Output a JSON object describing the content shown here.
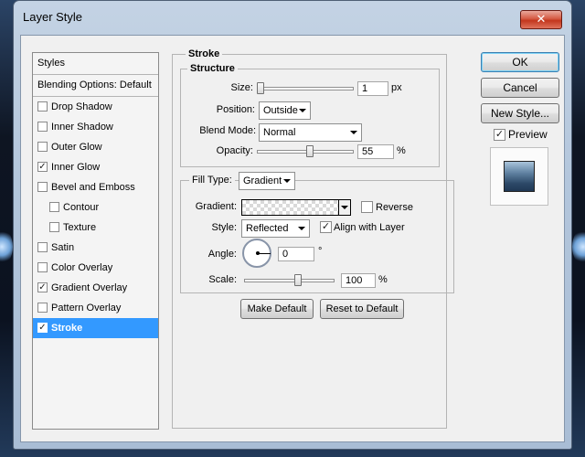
{
  "window": {
    "title": "Layer Style",
    "close_glyph": "✕"
  },
  "styles_panel": {
    "header": "Styles",
    "blend_options": "Blending Options: Default",
    "items": [
      {
        "label": "Drop Shadow",
        "checked": false,
        "sub": false,
        "selected": false
      },
      {
        "label": "Inner Shadow",
        "checked": false,
        "sub": false,
        "selected": false
      },
      {
        "label": "Outer Glow",
        "checked": false,
        "sub": false,
        "selected": false
      },
      {
        "label": "Inner Glow",
        "checked": true,
        "sub": false,
        "selected": false
      },
      {
        "label": "Bevel and Emboss",
        "checked": false,
        "sub": false,
        "selected": false
      },
      {
        "label": "Contour",
        "checked": false,
        "sub": true,
        "selected": false
      },
      {
        "label": "Texture",
        "checked": false,
        "sub": true,
        "selected": false
      },
      {
        "label": "Satin",
        "checked": false,
        "sub": false,
        "selected": false
      },
      {
        "label": "Color Overlay",
        "checked": false,
        "sub": false,
        "selected": false
      },
      {
        "label": "Gradient Overlay",
        "checked": true,
        "sub": false,
        "selected": false
      },
      {
        "label": "Pattern Overlay",
        "checked": false,
        "sub": false,
        "selected": false
      },
      {
        "label": "Stroke",
        "checked": true,
        "sub": false,
        "selected": true
      }
    ]
  },
  "stroke": {
    "title": "Stroke",
    "structure": {
      "title": "Structure",
      "size_label": "Size:",
      "size_value": "1",
      "size_unit": "px",
      "size_level": 0.0,
      "position_label": "Position:",
      "position_value": "Outside",
      "blend_label": "Blend Mode:",
      "blend_value": "Normal",
      "opacity_label": "Opacity:",
      "opacity_value": "55",
      "opacity_unit": "%",
      "opacity_level": 0.55
    },
    "fill": {
      "type_label": "Fill Type:",
      "type_value": "Gradient",
      "gradient_label": "Gradient:",
      "reverse_label": "Reverse",
      "reverse_checked": false,
      "style_label": "Style:",
      "style_value": "Reflected",
      "align_label": "Align with Layer",
      "align_checked": true,
      "angle_label": "Angle:",
      "angle_value": "0",
      "angle_unit": "°",
      "scale_label": "Scale:",
      "scale_value": "100",
      "scale_unit": "%",
      "scale_level": 0.6
    },
    "make_default": "Make Default",
    "reset_default": "Reset to Default"
  },
  "actions": {
    "ok": "OK",
    "cancel": "Cancel",
    "new_style": "New Style...",
    "preview_label": "Preview",
    "preview_checked": true
  },
  "colors": {
    "selection": "#3399ff",
    "preview_top": "#a9c4db",
    "preview_bottom": "#203855"
  }
}
